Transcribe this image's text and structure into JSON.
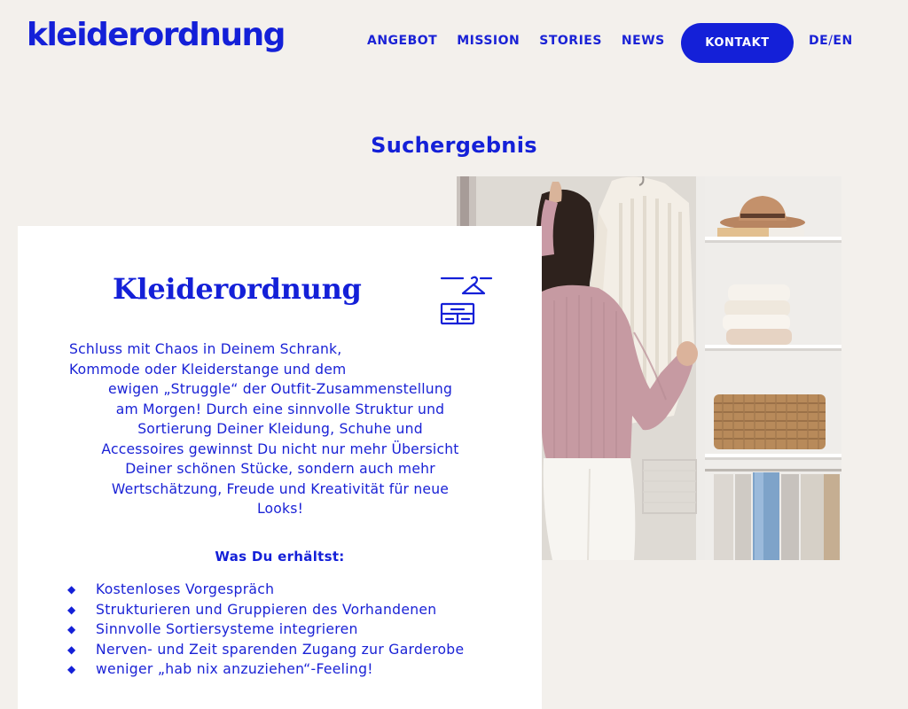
{
  "header": {
    "logo": "kleiderordnung",
    "nav": [
      "ANGEBOT",
      "MISSION",
      "STORIES",
      "NEWS"
    ],
    "cta": "KONTAKT",
    "lang": {
      "de": "DE",
      "sep": "/",
      "en": "EN"
    }
  },
  "main": {
    "title": "Suchergebnis",
    "card": {
      "title": "Kleiderordnung",
      "icon": "hanger-drawer-icon",
      "text_lines": [
        "Schluss mit Chaos in Deinem Schrank,",
        "Kommode oder Kleiderstange und dem",
        "ewigen „Struggle“ der Outfit-Zusammenstellung",
        "am Morgen! Durch eine sinnvolle Struktur und",
        "Sortierung Deiner Kleidung, Schuhe und",
        "Accessoires gewinnst Du nicht nur mehr Übersicht",
        "Deiner schönen Stücke, sondern auch mehr",
        "Wertschätzung, Freude und Kreativität für neue",
        "Looks!"
      ],
      "subheading": "Was Du erhältst:",
      "bullet_icon": "diamond-bullet-icon",
      "list": [
        "Kostenloses Vorgespräch",
        "Strukturieren und Gruppieren des Vorhandenen",
        "Sinnvolle Sortiersysteme integrieren",
        "Nerven- und Zeit sparenden Zugang zur Garderobe",
        "weniger „hab nix anzuziehen“-Feeling!"
      ]
    },
    "photo": {
      "icon": "wardrobe-photo"
    }
  },
  "colors": {
    "brand": "#1420d8",
    "background": "#f3f0ec",
    "card": "#ffffff"
  }
}
